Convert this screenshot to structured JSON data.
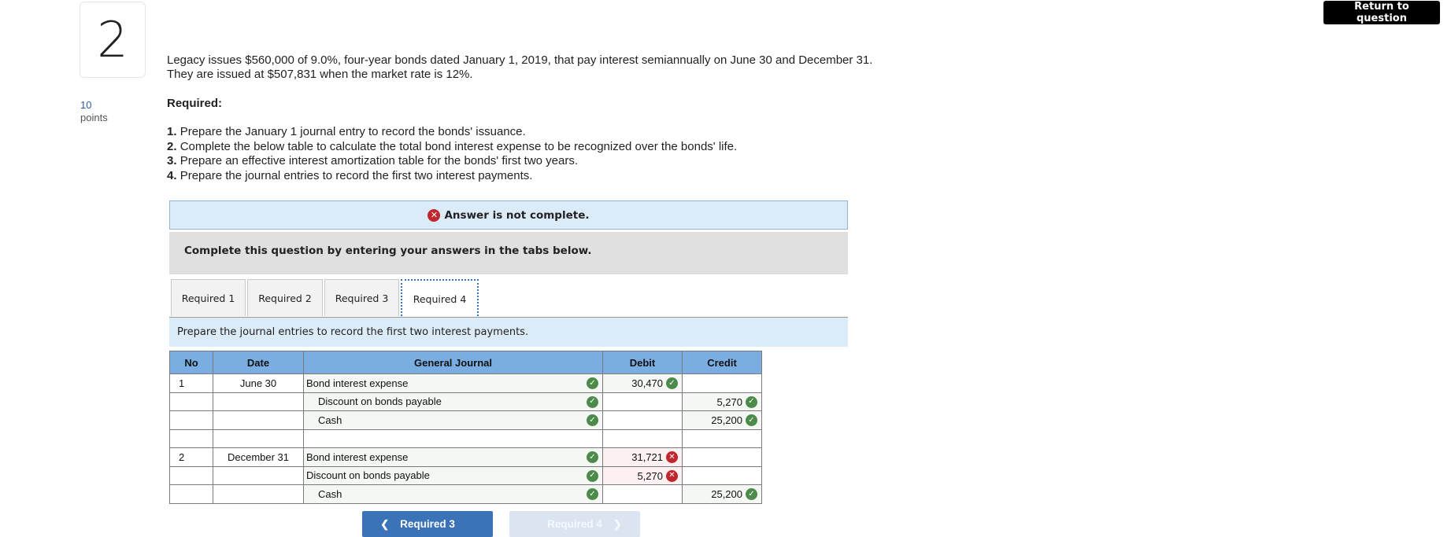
{
  "question": {
    "number": "2",
    "points_value": "10",
    "points_label": "points"
  },
  "header": {
    "return_button": "Return to question"
  },
  "problem": {
    "intro_line1": "Legacy issues $560,000 of 9.0%, four-year bonds dated January 1, 2019, that pay interest semiannually on June 30 and December 31.",
    "intro_line2": "They are issued at $507,831 when the market rate is 12%.",
    "required_heading": "Required:",
    "requirements": [
      {
        "num": "1.",
        "text": "Prepare the January 1 journal entry to record the bonds' issuance."
      },
      {
        "num": "2.",
        "text": "Complete the below table to calculate the total bond interest expense to be recognized over the bonds' life."
      },
      {
        "num": "3.",
        "text": "Prepare an effective interest amortization table for the bonds' first two years."
      },
      {
        "num": "4.",
        "text": "Prepare the journal entries to record the first two interest payments."
      }
    ]
  },
  "status": {
    "icon": "x-circle-icon",
    "message": "Answer is not complete."
  },
  "instructions_bar": "Complete this question by entering your answers in the tabs below.",
  "tabs": [
    {
      "label": "Required 1",
      "active": false
    },
    {
      "label": "Required 2",
      "active": false
    },
    {
      "label": "Required 3",
      "active": false
    },
    {
      "label": "Required 4",
      "active": true
    }
  ],
  "tab_instruction": "Prepare the journal entries to record the first two interest payments.",
  "journal": {
    "headers": {
      "no": "No",
      "date": "Date",
      "general_journal": "General Journal",
      "debit": "Debit",
      "credit": "Credit"
    },
    "rows": [
      {
        "no": "1",
        "date": "June 30",
        "account": "Bond interest expense",
        "indent": false,
        "account_status": "correct",
        "debit": "30,470",
        "debit_status": "correct",
        "credit": "",
        "credit_status": ""
      },
      {
        "no": "",
        "date": "",
        "account": "Discount on bonds payable",
        "indent": true,
        "account_status": "correct",
        "debit": "",
        "debit_status": "",
        "credit": "5,270",
        "credit_status": "correct"
      },
      {
        "no": "",
        "date": "",
        "account": "Cash",
        "indent": true,
        "account_status": "correct",
        "debit": "",
        "debit_status": "",
        "credit": "25,200",
        "credit_status": "correct"
      },
      {
        "no": "",
        "date": "",
        "account": "",
        "indent": false,
        "account_status": "",
        "debit": "",
        "debit_status": "",
        "credit": "",
        "credit_status": ""
      },
      {
        "no": "2",
        "date": "December 31",
        "account": "Bond interest expense",
        "indent": false,
        "account_status": "correct",
        "debit": "31,721",
        "debit_status": "incorrect",
        "credit": "",
        "credit_status": ""
      },
      {
        "no": "",
        "date": "",
        "account": "Discount on bonds payable",
        "indent": false,
        "account_status": "correct",
        "debit": "5,270",
        "debit_status": "incorrect",
        "credit": "",
        "credit_status": ""
      },
      {
        "no": "",
        "date": "",
        "account": "Cash",
        "indent": true,
        "account_status": "correct",
        "debit": "",
        "debit_status": "",
        "credit": "25,200",
        "credit_status": "correct"
      }
    ]
  },
  "navigation": {
    "prev_label": "Required 3",
    "next_label": "Required 4",
    "next_enabled": false
  },
  "colors": {
    "correct": "#4c8b4a",
    "incorrect": "#c0262d",
    "header_blue": "#7aaee3",
    "primary_button": "#3b73b9"
  }
}
